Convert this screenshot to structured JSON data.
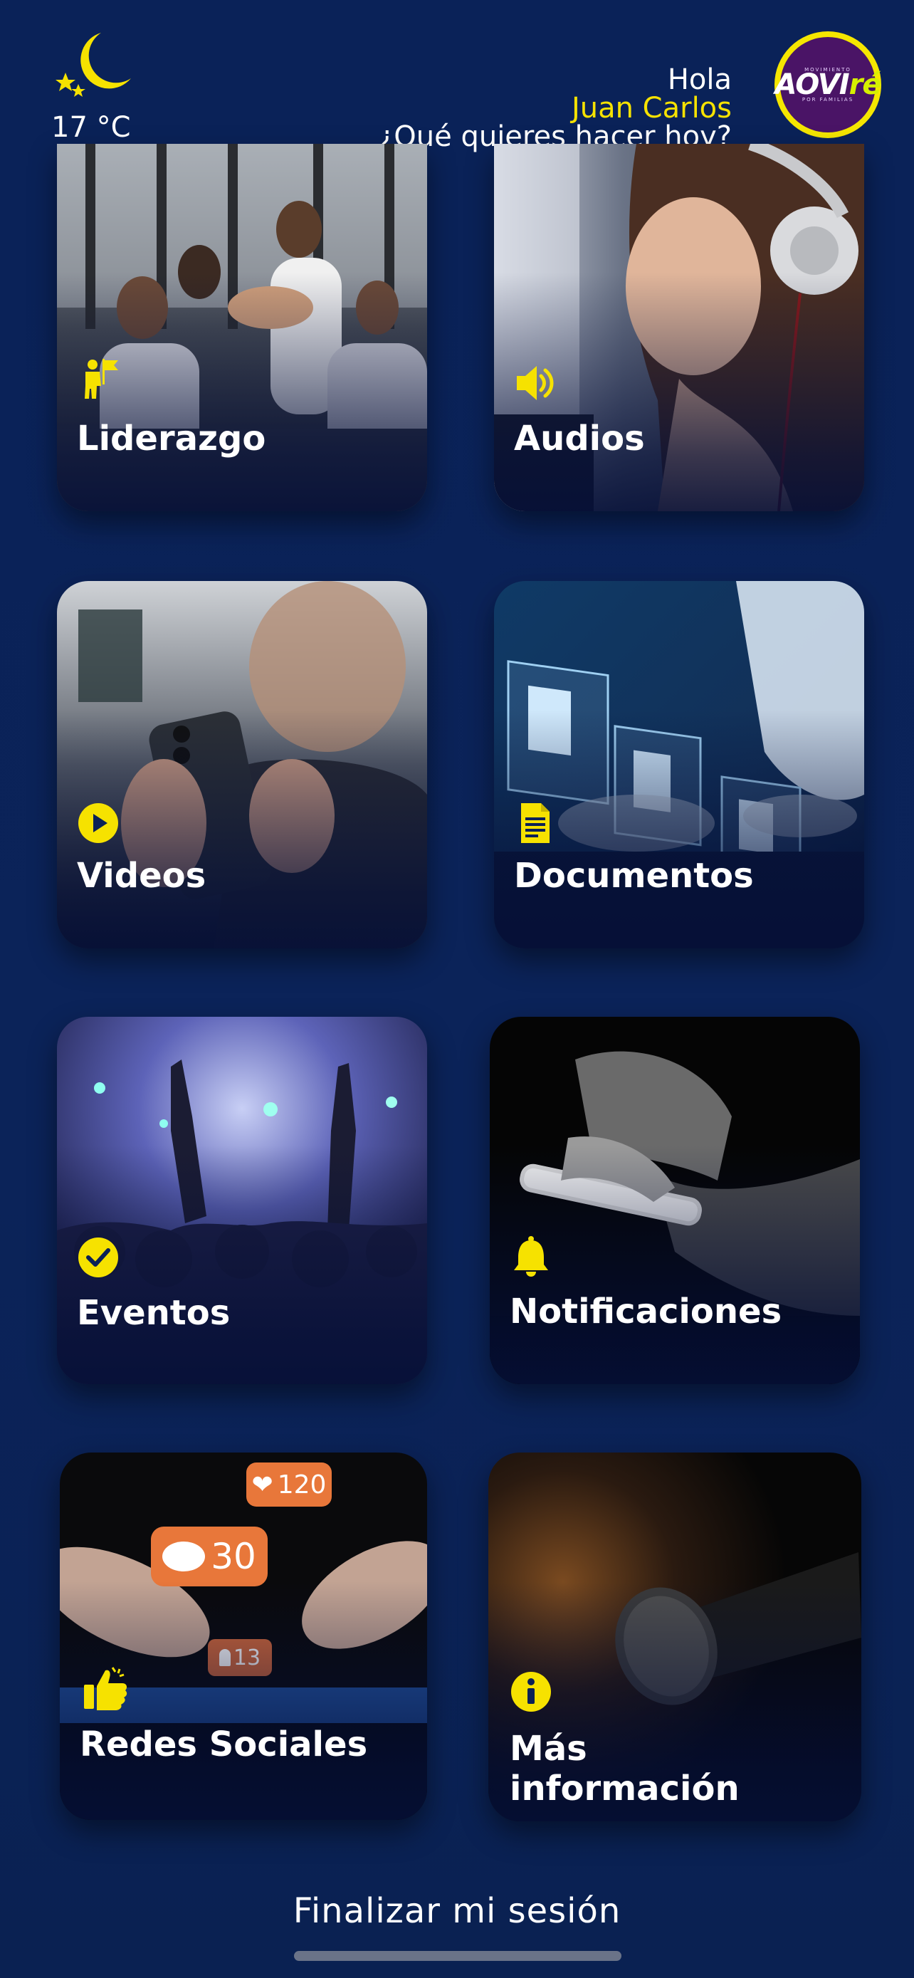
{
  "header": {
    "temperature": "17 °C",
    "hello": "Hola",
    "user_name": "Juan Carlos",
    "question": "¿Qué quieres hacer hoy?",
    "logo": {
      "top_text": "MOVIMIENTO",
      "main_text": "AOVI",
      "accent_text": "ré",
      "bottom_text": "POR FAMILIAS"
    }
  },
  "cards": [
    {
      "label": "Liderazgo",
      "icon": "leader-flag-icon"
    },
    {
      "label": "Audios",
      "icon": "speaker-icon"
    },
    {
      "label": "Videos",
      "icon": "play-icon"
    },
    {
      "label": "Documentos",
      "icon": "document-icon"
    },
    {
      "label": "Eventos",
      "icon": "check-icon"
    },
    {
      "label": "Notificaciones",
      "icon": "bell-icon"
    },
    {
      "label": "Redes Sociales",
      "icon": "thumbs-up-icon"
    },
    {
      "label": "Más información",
      "icon": "info-icon"
    }
  ],
  "social_badges": {
    "likes": "120",
    "comments": "30",
    "followers": "13"
  },
  "footer": {
    "logout_label": "Finalizar mi sesión"
  },
  "colors": {
    "background": "#0b2156",
    "accent_yellow": "#f6e200",
    "text": "#ffffff",
    "social_badge": "#e8773a"
  }
}
